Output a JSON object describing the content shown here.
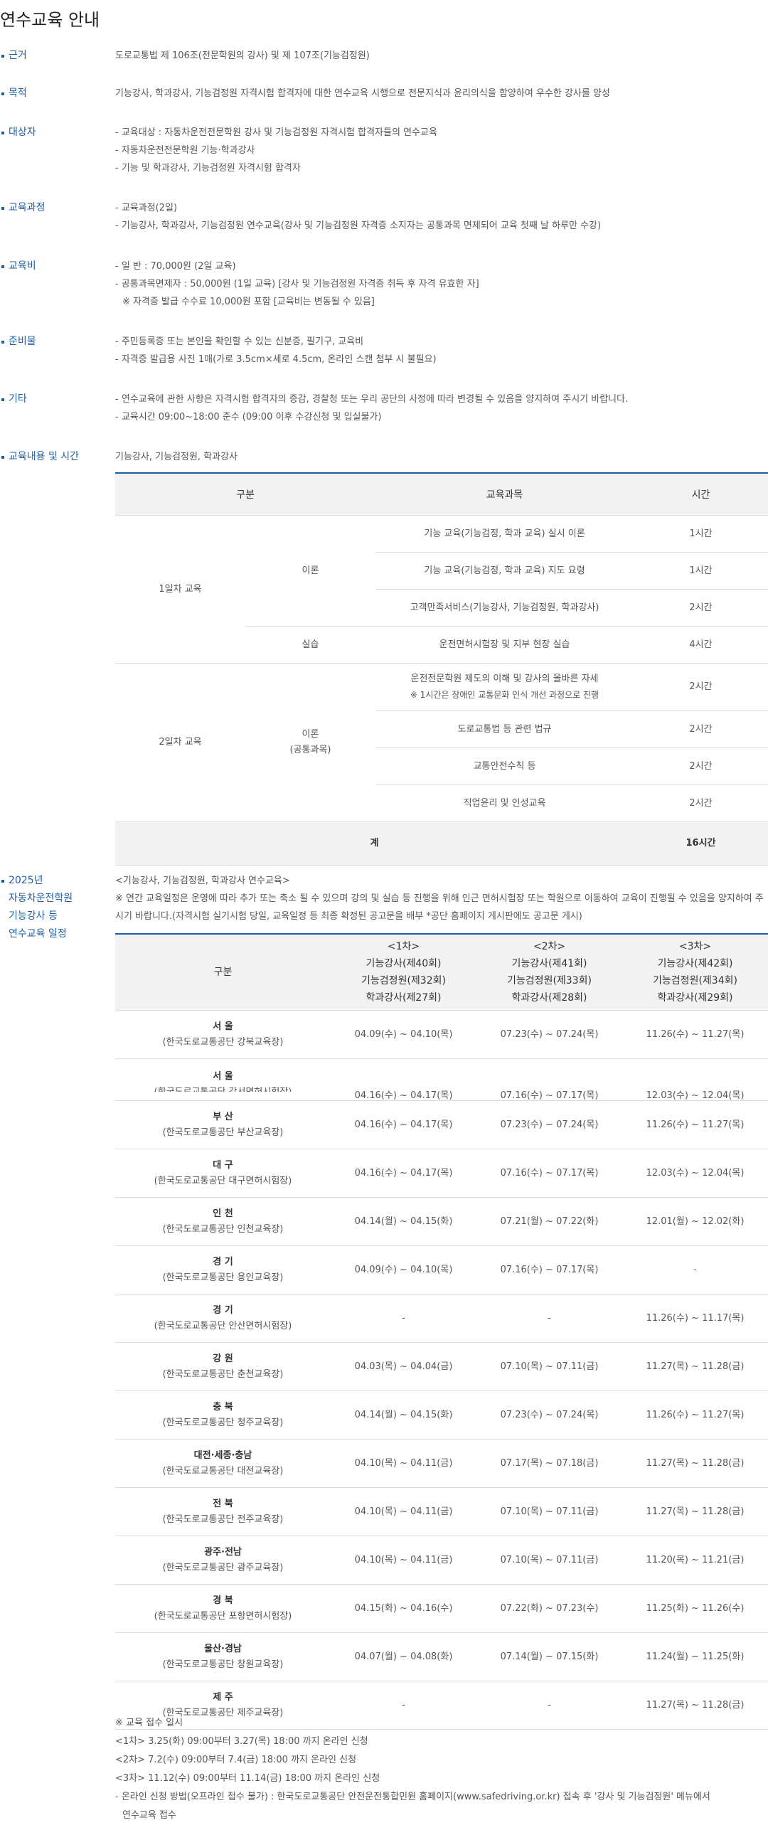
{
  "title": "연수교육 안내",
  "sections": [
    {
      "label": "근거",
      "lines": [
        "도로교통법 제 106조(전문학원의 강사) 및 제 107조(기능검정원)"
      ]
    },
    {
      "label": "목적",
      "lines": [
        "기능강사, 학과강사, 기능검정원 자격시험 합격자에 대한 연수교육 시행으로 전문지식과 윤리의식을 함양하여 우수한 강사를 양성"
      ]
    },
    {
      "label": "대상자",
      "lines": [
        "- 교육대상 : 자동차운전전문학원 강사 및 기능검정원 자격시험 합격자들의 연수교육",
        "- 자동차운전전문학원 기능·학과강사",
        "- 기능 및 학과강사, 기능검정원 자격시험 합격자"
      ]
    },
    {
      "label": "교육과정",
      "lines": [
        "- 교육과정(2일)",
        "- 기능강사, 학과강사, 기능검정원 연수교육(강사 및 기능검정원 자격증 소지자는 공통과목 면제되어 교육 첫째 날 하루만 수강)"
      ]
    },
    {
      "label": "교육비",
      "lines": [
        "- 일 반 : 70,000원 (2일 교육)",
        "- 공통과목면제자 : 50,000원 (1일 교육) [강사 및 기능검정원 자격증 취득 후 자격 유효한 자]",
        "※ 자격증 발급 수수료 10,000원 포함 [교육비는 변동될 수 있음]"
      ]
    },
    {
      "label": "준비물",
      "lines": [
        "- 주민등록증 또는 본인을 확인할 수 있는 신분증, 필기구, 교육비",
        "- 자격증 발급용 사진 1매(가로 3.5cm×세로 4.5cm, 온라인 스캔 첨부 시 불필요)"
      ]
    },
    {
      "label": "기타",
      "lines": [
        "- 연수교육에 관한 사항은 자격시험 합격자의 증감, 경찰청 또는 우리 공단의 사정에 따라 변경될 수 있음을 양지하여 주시기 바랍니다.",
        "- 교육시간 09:00~18:00 준수 (09:00 이후 수강신청 및 입실불가)"
      ]
    },
    {
      "label": "교육내용 및 시간",
      "lines": [
        "기능강사, 기능검정원, 학과강사"
      ]
    }
  ],
  "curriculum": {
    "headers": [
      "구분",
      "교육과목",
      "시간"
    ],
    "day1": "1일차 교육",
    "day2": "2일차 교육",
    "theory": "이론",
    "practice": "실습",
    "theory_common_1": "이론",
    "theory_common_2": "(공통과목)",
    "subjects": [
      {
        "name": "기능 교육(기능검정, 학과 교육) 실시 이론",
        "hours": "1시간"
      },
      {
        "name": "기능 교육(기능검정, 학과 교육) 지도 요령",
        "hours": "1시간"
      },
      {
        "name": "고객만족서비스(기능강사, 기능검정원, 학과강사)",
        "hours": "2시간"
      },
      {
        "name": "운전면허시험장 및 지부 현장 실습",
        "hours": "4시간"
      },
      {
        "name": "운전전문학원 제도의 이해 및 강사의 올바른 자세",
        "note": "※ 1시간은 장애인 교통문화 인식 개선 과정으로 진행",
        "hours": "2시간"
      },
      {
        "name": "도로교통법 등 관련 법규",
        "hours": "2시간"
      },
      {
        "name": "교통안전수칙 등",
        "hours": "2시간"
      },
      {
        "name": "직업윤리 및 인성교육",
        "hours": "2시간"
      }
    ],
    "total_label": "계",
    "total_hours": "16시간"
  },
  "schedule": {
    "label_lines": [
      "2025년",
      "자동차운전학원",
      "기능강사 등",
      "연수교육 일정"
    ],
    "subtitle": "<기능강사, 기능검정원, 학과강사 연수교육>",
    "notice": "※ 연간 교육일정은 운영에 따라 추가 또는 축소 될 수 있으며 강의 및 실습 등 진행을 위해 인근 면허시험장 또는 학원으로 이동하여 교육이 진행될 수 있음을 양지하여 주시기 바랍니다.(자격시험 실기시험 당일, 교육일정 등 최종 확정된 공고문을 배부 *공단 홈페이지 게시판에도 공고문 게시)",
    "col_header": "구분",
    "rounds": [
      {
        "num": "<1차>",
        "l1": "기능강사(제40회)",
        "l2": "기능검정원(제32회)",
        "l3": "학과강사(제27회)"
      },
      {
        "num": "<2차>",
        "l1": "기능강사(제41회)",
        "l2": "기능검정원(제33회)",
        "l3": "학과강사(제28회)"
      },
      {
        "num": "<3차>",
        "l1": "기능강사(제42회)",
        "l2": "기능검정원(제34회)",
        "l3": "학과강사(제29회)"
      }
    ],
    "rows": [
      {
        "region": "서 울",
        "venue": "(한국도로교통공단 강북교육장)",
        "d": [
          "04.09(수) ~ 04.10(목)",
          "07.23(수) ~ 07.24(목)",
          "11.26(수) ~ 11.27(목)"
        ]
      },
      {
        "region": "서 울",
        "venue": "(한국도로교통공단 강서면허시험장)",
        "d": [
          "04.16(수) ~ 04.17(목)",
          "07.16(수) ~ 07.17(목)",
          "12.03(수) ~ 12.04(목)"
        ]
      },
      {
        "region": "부 산",
        "venue": "(한국도로교통공단 부산교육장)",
        "d": [
          "04.16(수) ~ 04.17(목)",
          "07.23(수) ~ 07.24(목)",
          "11.26(수) ~ 11.27(목)"
        ]
      },
      {
        "region": "대 구",
        "venue": "(한국도로교통공단 대구면허시험장)",
        "d": [
          "04.16(수) ~ 04.17(목)",
          "07.16(수) ~ 07.17(목)",
          "12.03(수) ~ 12.04(목)"
        ]
      },
      {
        "region": "인 천",
        "venue": "(한국도로교통공단 인천교육장)",
        "d": [
          "04.14(월) ~ 04.15(화)",
          "07.21(월) ~ 07.22(화)",
          "12.01(월) ~ 12.02(화)"
        ]
      },
      {
        "region": "경 기",
        "venue": "(한국도로교통공단 용인교육장)",
        "d": [
          "04.09(수) ~ 04.10(목)",
          "07.16(수) ~ 07.17(목)",
          "-"
        ]
      },
      {
        "region": "경 기",
        "venue": "(한국도로교통공단 안산면허시험장)",
        "d": [
          "-",
          "-",
          "11.26(수) ~ 11.17(목)"
        ]
      },
      {
        "region": "강 원",
        "venue": "(한국도로교통공단 춘천교육장)",
        "d": [
          "04.03(목) ~ 04.04(금)",
          "07.10(목) ~ 07.11(금)",
          "11.27(목) ~ 11.28(금)"
        ]
      },
      {
        "region": "충 북",
        "venue": "(한국도로교통공단 청주교육장)",
        "d": [
          "04.14(월) ~ 04.15(화)",
          "07.23(수) ~ 07.24(목)",
          "11.26(수) ~ 11.27(목)"
        ]
      },
      {
        "region": "대전·세종·충남",
        "venue": "(한국도로교통공단 대전교육장)",
        "d": [
          "04.10(목) ~ 04.11(금)",
          "07.17(목) ~ 07.18(금)",
          "11.27(목) ~ 11.28(금)"
        ]
      },
      {
        "region": "전 북",
        "venue": "(한국도로교통공단 전주교육장)",
        "d": [
          "04.10(목) ~ 04.11(금)",
          "07.10(목) ~ 07.11(금)",
          "11.27(목) ~ 11.28(금)"
        ]
      },
      {
        "region": "광주·전남",
        "venue": "(한국도로교통공단 광주교육장)",
        "d": [
          "04.10(목) ~ 04.11(금)",
          "07.10(목) ~ 07.11(금)",
          "11.20(목) ~ 11.21(금)"
        ]
      },
      {
        "region": "경 북",
        "venue": "(한국도로교통공단 포항면허시험장)",
        "d": [
          "04.15(화) ~ 04.16(수)",
          "07.22(화) ~ 07.23(수)",
          "11.25(화) ~ 11.26(수)"
        ]
      },
      {
        "region": "울산·경남",
        "venue": "(한국도로교통공단 창원교육장)",
        "d": [
          "04.07(월) ~ 04.08(화)",
          "07.14(월) ~ 07.15(화)",
          "11.24(월) ~ 11.25(화)"
        ]
      },
      {
        "region": "제 주",
        "venue": "(한국도로교통공단 제주교육장)",
        "d": [
          "-",
          "-",
          "11.27(목) ~ 11.28(금)"
        ]
      }
    ],
    "notes": [
      "※ 교육 접수 일시",
      "<1차> 3.25(화) 09:00부터 3.27(목) 18:00 까지 온라인 신청",
      "<2차> 7.2(수) 09:00부터 7.4(금) 18:00 까지 온라인 신청",
      "<3차> 11.12(수) 09:00부터 11.14(금) 18:00 까지 온라인 신청",
      "- 온라인 신청 방법(오프라인 접수 불가) : 한국도로교통공단 안전운전통합민원 홈페이지(www.safedriving.or.kr) 접속 후 '강사 및 기능검정원' 메뉴에서",
      "연수교육 접수"
    ]
  }
}
